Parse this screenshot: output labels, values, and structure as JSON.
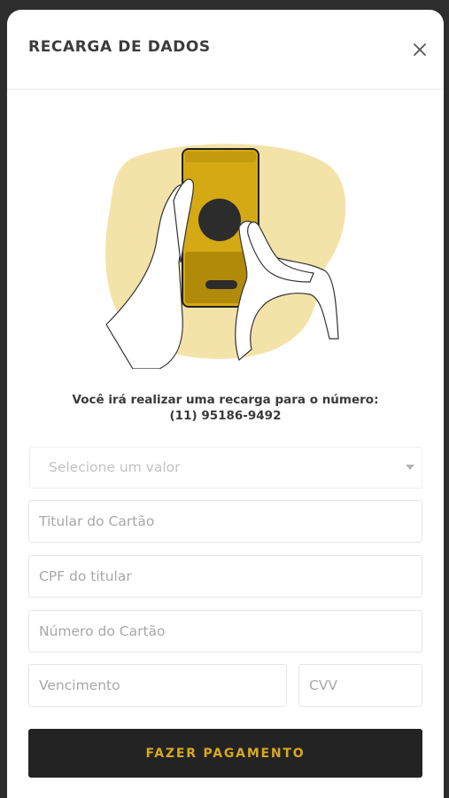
{
  "modal": {
    "title": "RECARGA DE DADOS",
    "close_icon": "close-icon"
  },
  "illustration": {
    "name": "hand-holding-phone-illustration",
    "colors": {
      "blob": "#f4e3a8",
      "phone": "#d4a914",
      "phone_dark": "#b18a0a",
      "circle": "#2c2c2c"
    }
  },
  "message": {
    "line1": "Você irá realizar uma recarga para o número:",
    "number": "(11) 95186-9492"
  },
  "form": {
    "value_select": {
      "placeholder": "Selecione um valor"
    },
    "card_holder": {
      "placeholder": "Titular do Cartão",
      "value": ""
    },
    "cpf": {
      "placeholder": "CPF do titular",
      "value": ""
    },
    "card_number": {
      "placeholder": "Número do Cartão",
      "value": ""
    },
    "expiry": {
      "placeholder": "Vencimento",
      "value": ""
    },
    "cvv": {
      "placeholder": "CVV",
      "value": ""
    }
  },
  "actions": {
    "pay_label": "FAZER PAGAMENTO"
  },
  "colors": {
    "accent": "#d6a91e",
    "button_bg": "#232323",
    "backdrop": "#2d2d2d"
  }
}
